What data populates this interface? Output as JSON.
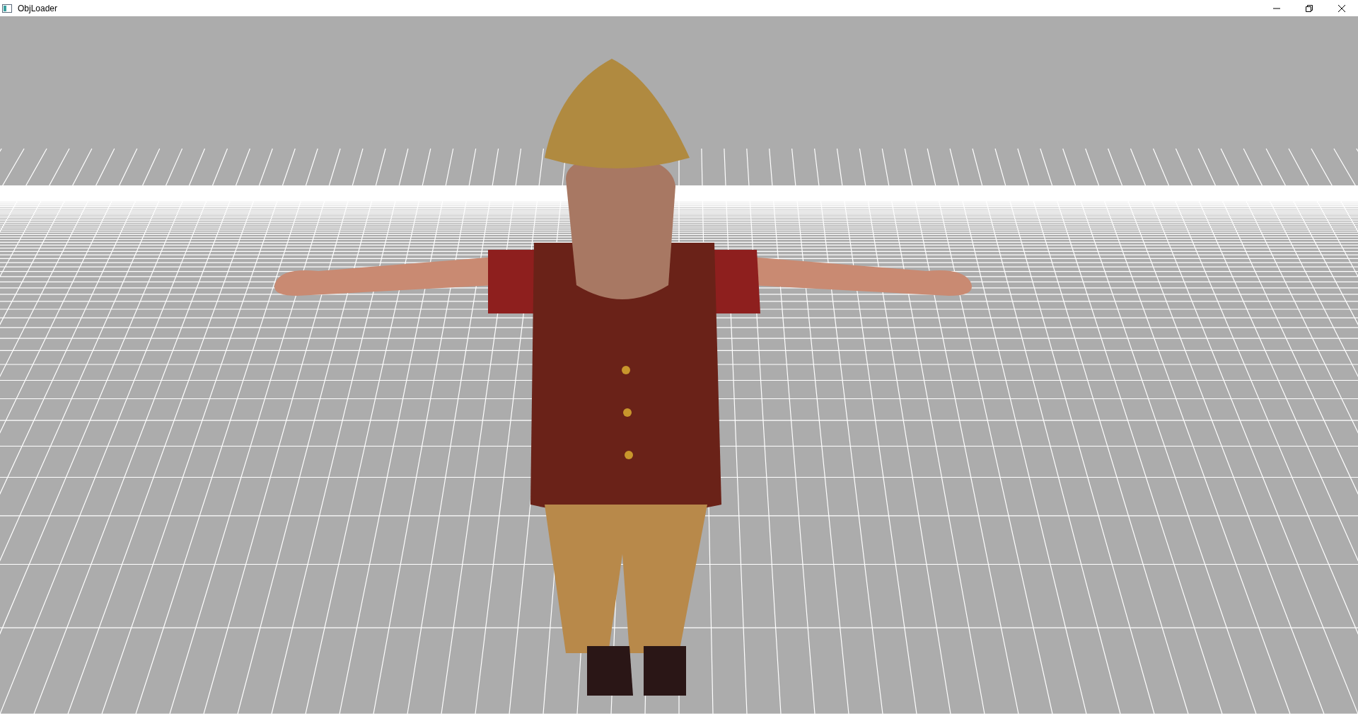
{
  "window": {
    "title": "ObjLoader"
  }
}
